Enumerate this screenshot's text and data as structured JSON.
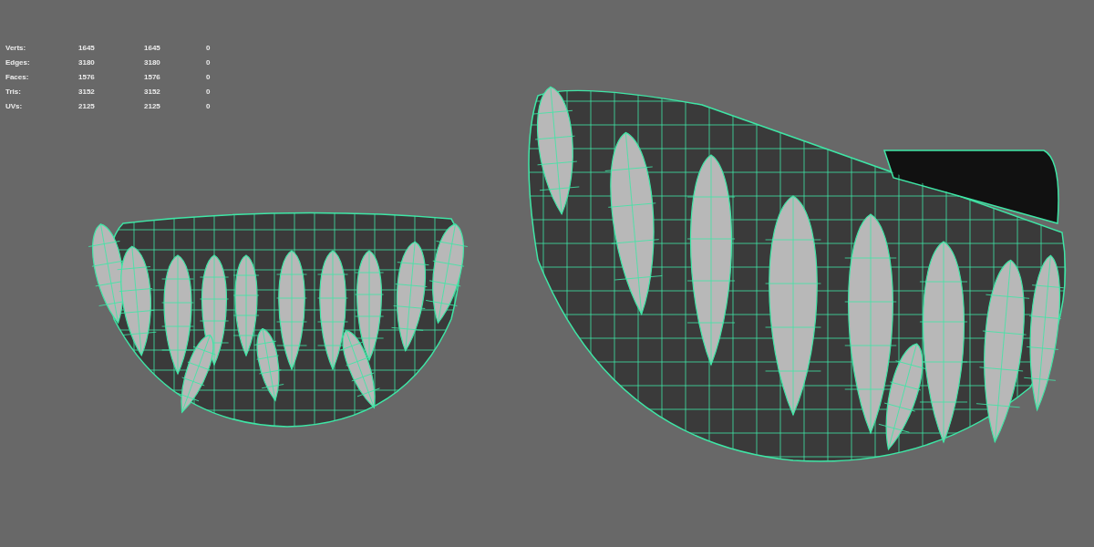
{
  "hud": {
    "rows": [
      {
        "label": "Verts:",
        "values": [
          "1645",
          "1645",
          "0"
        ]
      },
      {
        "label": "Edges:",
        "values": [
          "3180",
          "3180",
          "0"
        ]
      },
      {
        "label": "Faces:",
        "values": [
          "1576",
          "1576",
          "0"
        ]
      },
      {
        "label": "Tris:",
        "values": [
          "3152",
          "3152",
          "0"
        ]
      },
      {
        "label": "UVs:",
        "values": [
          "2125",
          "2125",
          "0"
        ]
      }
    ]
  }
}
